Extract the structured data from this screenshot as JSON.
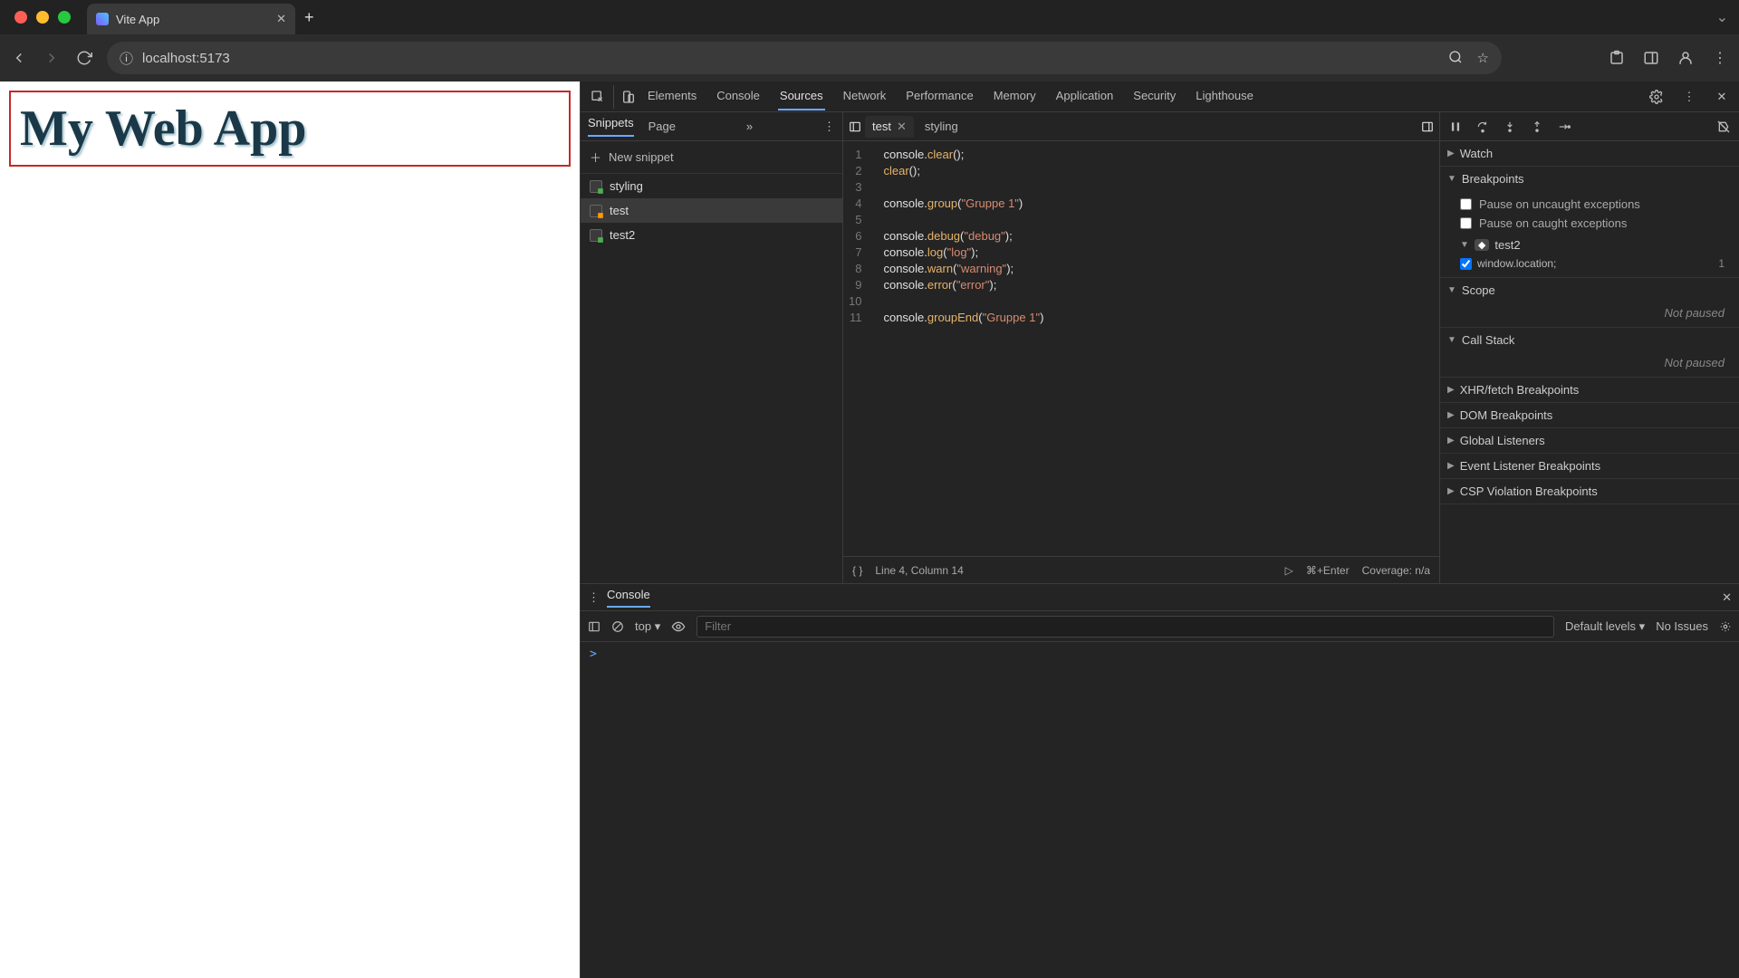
{
  "browser": {
    "tab_title": "Vite App",
    "url": "localhost:5173"
  },
  "page": {
    "heading": "My Web App"
  },
  "devtools": {
    "panels": [
      "Elements",
      "Console",
      "Sources",
      "Network",
      "Performance",
      "Memory",
      "Application",
      "Security",
      "Lighthouse"
    ],
    "active_panel": "Sources"
  },
  "sources_nav": {
    "tabs": [
      "Snippets",
      "Page"
    ],
    "new_snippet_label": "New snippet",
    "snippets": [
      "styling",
      "test",
      "test2"
    ],
    "active_snippet": "test"
  },
  "editor": {
    "open_tabs": [
      "test",
      "styling"
    ],
    "active_tab": "test",
    "code_lines": [
      {
        "n": 1,
        "plain": "console.",
        "method": "clear",
        "after": "();"
      },
      {
        "n": 2,
        "plain": "",
        "method": "clear",
        "after": "();"
      },
      {
        "n": 3,
        "plain": "",
        "method": "",
        "after": ""
      },
      {
        "n": 4,
        "plain": "console.",
        "method": "group",
        "after": "(",
        "str": "\"Gruppe 1\"",
        "tail": ")"
      },
      {
        "n": 5,
        "plain": "",
        "method": "",
        "after": ""
      },
      {
        "n": 6,
        "plain": "console.",
        "method": "debug",
        "after": "(",
        "str": "\"debug\"",
        "tail": ");"
      },
      {
        "n": 7,
        "plain": "console.",
        "method": "log",
        "after": "(",
        "str": "\"log\"",
        "tail": ");"
      },
      {
        "n": 8,
        "plain": "console.",
        "method": "warn",
        "after": "(",
        "str": "\"warning\"",
        "tail": ");"
      },
      {
        "n": 9,
        "plain": "console.",
        "method": "error",
        "after": "(",
        "str": "\"error\"",
        "tail": ");"
      },
      {
        "n": 10,
        "plain": "",
        "method": "",
        "after": ""
      },
      {
        "n": 11,
        "plain": "console.",
        "method": "groupEnd",
        "after": "(",
        "str": "\"Gruppe 1\"",
        "tail": ")"
      }
    ],
    "status": "Line 4, Column 14",
    "shortcut": "⌘+Enter",
    "coverage": "Coverage: n/a"
  },
  "debugger": {
    "sections": {
      "watch": "Watch",
      "breakpoints": "Breakpoints",
      "pause_uncaught": "Pause on uncaught exceptions",
      "pause_caught": "Pause on caught exceptions",
      "bp_group": "test2",
      "bp_item": "window.location;",
      "bp_line": "1",
      "scope": "Scope",
      "scope_state": "Not paused",
      "callstack": "Call Stack",
      "callstack_state": "Not paused",
      "xhr": "XHR/fetch Breakpoints",
      "dom": "DOM Breakpoints",
      "global": "Global Listeners",
      "event": "Event Listener Breakpoints",
      "csp": "CSP Violation Breakpoints"
    }
  },
  "console": {
    "tab": "Console",
    "context": "top",
    "filter_placeholder": "Filter",
    "levels": "Default levels",
    "issues": "No Issues"
  }
}
